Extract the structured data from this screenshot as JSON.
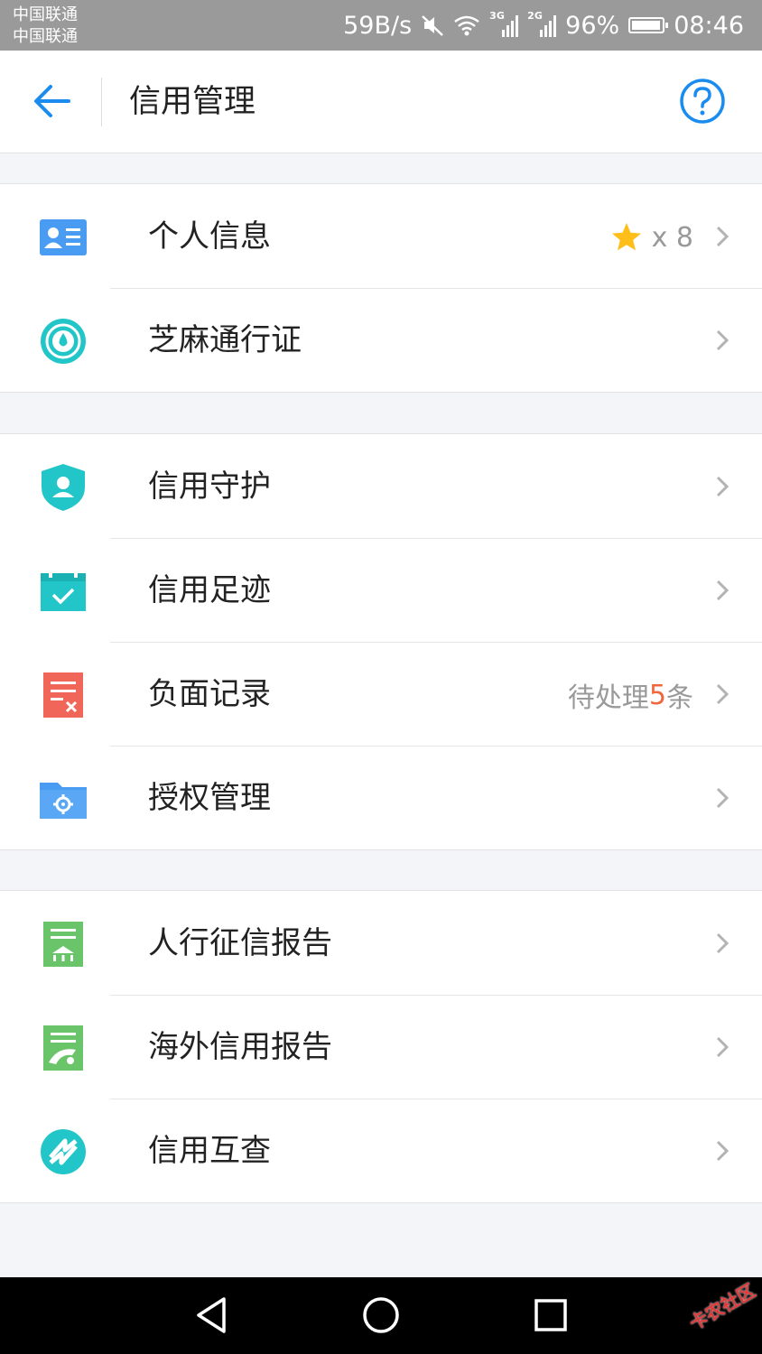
{
  "status_bar": {
    "carrier_1": "中国联通",
    "carrier_2": "中国联通",
    "speed": "59B/s",
    "signal_1": "3G",
    "signal_2": "2G",
    "battery": "96%",
    "battery_level": 0.96,
    "time": "08:46"
  },
  "header": {
    "title": "信用管理"
  },
  "groups": [
    {
      "items": [
        {
          "label": "个人信息",
          "icon": "id-card-icon",
          "extra": "x 8"
        },
        {
          "label": "芝麻通行证",
          "icon": "sesame-pass-icon"
        }
      ]
    },
    {
      "items": [
        {
          "label": "信用守护",
          "icon": "shield-user-icon"
        },
        {
          "label": "信用足迹",
          "icon": "calendar-check-icon"
        },
        {
          "label": "负面记录",
          "icon": "record-x-icon",
          "extra_prefix": "待处理",
          "extra_count": "5",
          "extra_suffix": "条"
        },
        {
          "label": "授权管理",
          "icon": "folder-gear-icon"
        }
      ]
    },
    {
      "items": [
        {
          "label": "人行征信报告",
          "icon": "bank-report-icon"
        },
        {
          "label": "海外信用报告",
          "icon": "overseas-report-icon"
        },
        {
          "label": "信用互查",
          "icon": "mutual-check-icon"
        }
      ]
    }
  ],
  "watermark": "卡农社区",
  "colors": {
    "accent": "#1a8cf0",
    "teal": "#23c6c8",
    "red": "#f0675a",
    "green": "#6ac46a",
    "star": "#ffbe1a",
    "highlight": "#f0673e"
  }
}
